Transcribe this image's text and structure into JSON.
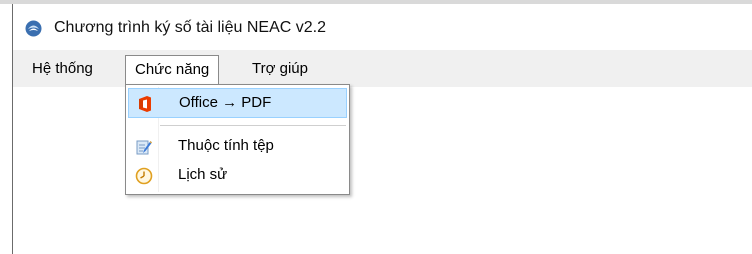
{
  "window": {
    "title": "Chương trình ký số tài liệu NEAC v2.2"
  },
  "menubar": {
    "items": [
      {
        "label": "Hệ thống"
      },
      {
        "label": "Chức năng",
        "open": true
      },
      {
        "label": "Trợ giúp"
      }
    ]
  },
  "dropdown": {
    "items": [
      {
        "label": "Office → PDF",
        "icon": "office-icon",
        "highlighted": true
      },
      {
        "label": "Thuộc tính tệp",
        "icon": "file-properties-icon"
      },
      {
        "label": "Lịch sử",
        "icon": "history-clock-icon"
      }
    ]
  },
  "colors": {
    "menubar_bg": "#f0f0f0",
    "highlight_bg": "#cce8ff",
    "highlight_border": "#99d1ff",
    "office_orange": "#eb3c00"
  }
}
